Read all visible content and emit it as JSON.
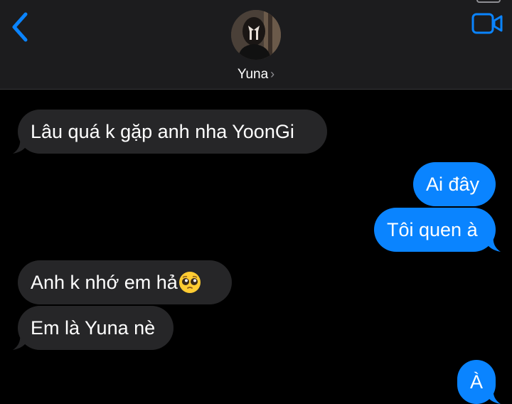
{
  "header": {
    "status_text": "",
    "contact_name": "Yuna",
    "chevron": "›",
    "back_icon": "chevron-left-icon",
    "video_icon": "video-camera-icon",
    "accent_color": "#0a84ff"
  },
  "messages": [
    {
      "side": "in",
      "text": "Lâu quá k gặp anh nha YoonGi"
    },
    {
      "side": "out",
      "text": "Ai đây"
    },
    {
      "side": "out",
      "text": "Tôi quen à"
    },
    {
      "side": "in",
      "text": "Anh k nhớ em hả",
      "emoji": "pleading-face"
    },
    {
      "side": "in",
      "text": "Em là Yuna nè"
    },
    {
      "side": "out",
      "text": "À"
    }
  ],
  "colors": {
    "incoming_bubble": "#262628",
    "outgoing_bubble": "#0a84ff",
    "header_bg": "#1c1c1e",
    "background": "#000000"
  }
}
